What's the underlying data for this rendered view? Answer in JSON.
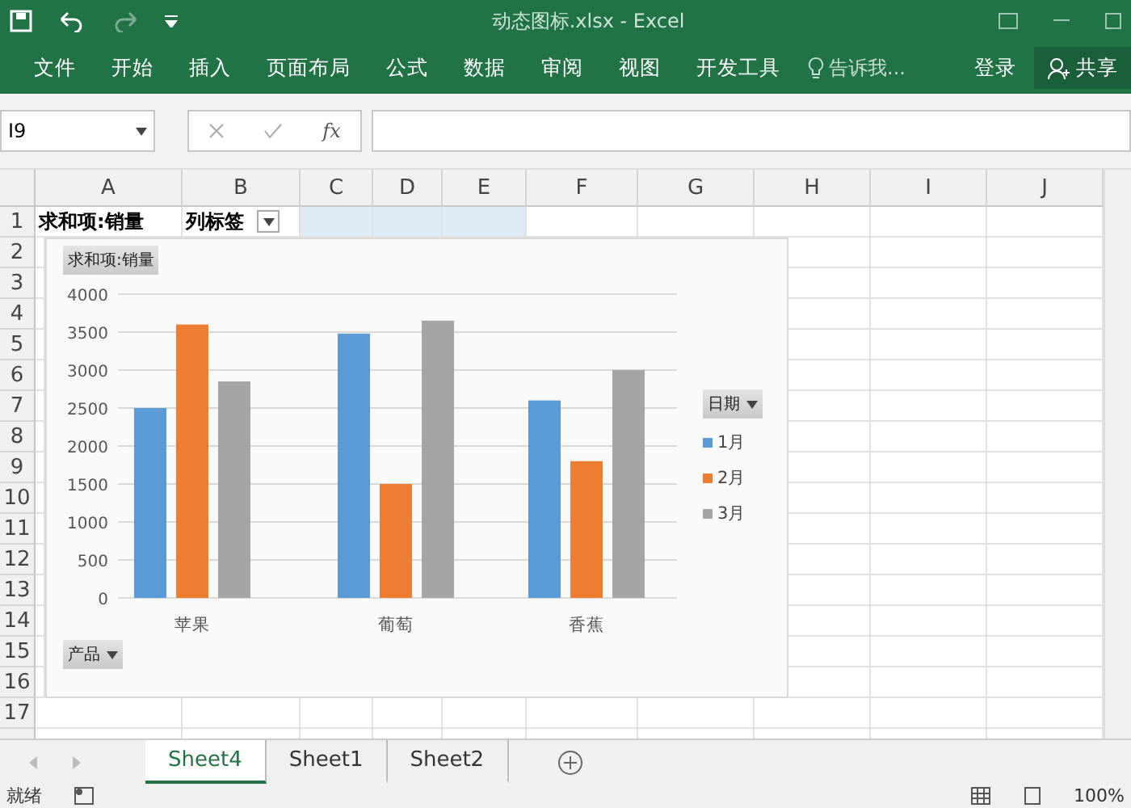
{
  "window": {
    "title": "动态图标.xlsx - Excel"
  },
  "ribbon": {
    "tabs": [
      "文件",
      "开始",
      "插入",
      "页面布局",
      "公式",
      "数据",
      "审阅",
      "视图",
      "开发工具"
    ],
    "tell_me": "告诉我...",
    "sign_in": "登录",
    "share": "共享"
  },
  "formula_bar": {
    "name_box": "I9",
    "fx": "fx"
  },
  "columns": [
    "A",
    "B",
    "C",
    "D",
    "E",
    "F",
    "G",
    "H",
    "I",
    "J"
  ],
  "rows": [
    "1",
    "2",
    "3",
    "4",
    "5",
    "6",
    "7",
    "8",
    "9",
    "10",
    "11",
    "12",
    "13",
    "14",
    "15",
    "16",
    "17"
  ],
  "cells": {
    "A1": "求和项:销量",
    "B1": "列标签"
  },
  "chart": {
    "value_field": "求和项:销量",
    "axis_field": "产品",
    "legend_field": "日期",
    "chart_data": {
      "type": "bar",
      "grid": true,
      "categories": [
        "苹果",
        "葡萄",
        "香蕉"
      ],
      "ylim": [
        0,
        4000
      ],
      "yticks": [
        0,
        500,
        1000,
        1500,
        2000,
        2500,
        3000,
        3500,
        4000
      ],
      "series": [
        {
          "name": "1月",
          "color": "#5b9bd5",
          "values": [
            2500,
            3480,
            2600
          ]
        },
        {
          "name": "2月",
          "color": "#ed7d31",
          "values": [
            3600,
            1500,
            1800
          ]
        },
        {
          "name": "3月",
          "color": "#a5a5a5",
          "values": [
            2850,
            3650,
            3000
          ]
        }
      ]
    }
  },
  "sheets": [
    {
      "label": "Sheet4",
      "selected": true
    },
    {
      "label": "Sheet1",
      "selected": false
    },
    {
      "label": "Sheet2",
      "selected": false
    }
  ],
  "status_bar": {
    "status": "就绪",
    "zoom": "100%"
  }
}
